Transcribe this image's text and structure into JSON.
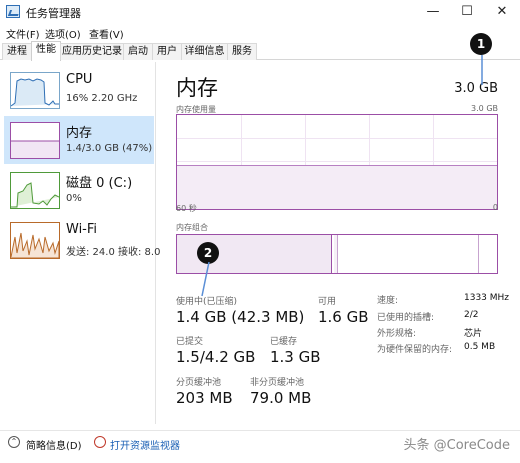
{
  "window": {
    "title": "任务管理器",
    "controls": {
      "minimize": "—",
      "maximize": "☐",
      "close": "✕"
    }
  },
  "menu": [
    "文件(F)",
    "选项(O)",
    "查看(V)"
  ],
  "tabs": [
    "进程",
    "性能",
    "应用历史记录",
    "启动",
    "用户",
    "详细信息",
    "服务"
  ],
  "active_tab": "性能",
  "sidebar": {
    "items": [
      {
        "name": "CPU",
        "sub": "16%  2.20 GHz",
        "icon": "cpu-graph-icon"
      },
      {
        "name": "内存",
        "sub": "1.4/3.0 GB (47%)",
        "icon": "memory-graph-icon",
        "selected": true
      },
      {
        "name": "磁盘 0 (C:)",
        "sub": "0%",
        "icon": "disk-graph-icon"
      },
      {
        "name": "Wi-Fi",
        "sub": "发送: 24.0  接收: 8.0",
        "icon": "wifi-graph-icon"
      }
    ]
  },
  "main": {
    "title": "内存",
    "total": "3.0 GB",
    "usage_label": "内存使用量",
    "usage_max": "3.0 GB",
    "time_label": "60 秒",
    "time_zero": "0",
    "usage_fraction": 0.47,
    "composition_label": "内存组合",
    "stats": {
      "in_use_label": "使用中(已压缩)",
      "in_use_value": "1.4 GB (42.3 MB)",
      "available_label": "可用",
      "available_value": "1.6 GB",
      "committed_label": "已提交",
      "committed_value": "1.5/4.2 GB",
      "cached_label": "已缓存",
      "cached_value": "1.3 GB",
      "paged_label": "分页缓冲池",
      "paged_value": "203 MB",
      "nonpaged_label": "非分页缓冲池",
      "nonpaged_value": "79.0 MB"
    },
    "details": [
      {
        "label": "速度:",
        "value": "1333 MHz"
      },
      {
        "label": "已使用的插槽:",
        "value": "2/2"
      },
      {
        "label": "外形规格:",
        "value": "芯片"
      },
      {
        "label": "为硬件保留的内存:",
        "value": "0.5 MB"
      }
    ]
  },
  "annotations": [
    "1",
    "2"
  ],
  "footer": {
    "brief": "简略信息(D)",
    "monitor": "打开资源监视器"
  },
  "watermark": "头条 @CoreCode",
  "colors": {
    "accent": "#9b4ea6",
    "selected": "#cfe6fb",
    "link": "#1a5fb4"
  }
}
